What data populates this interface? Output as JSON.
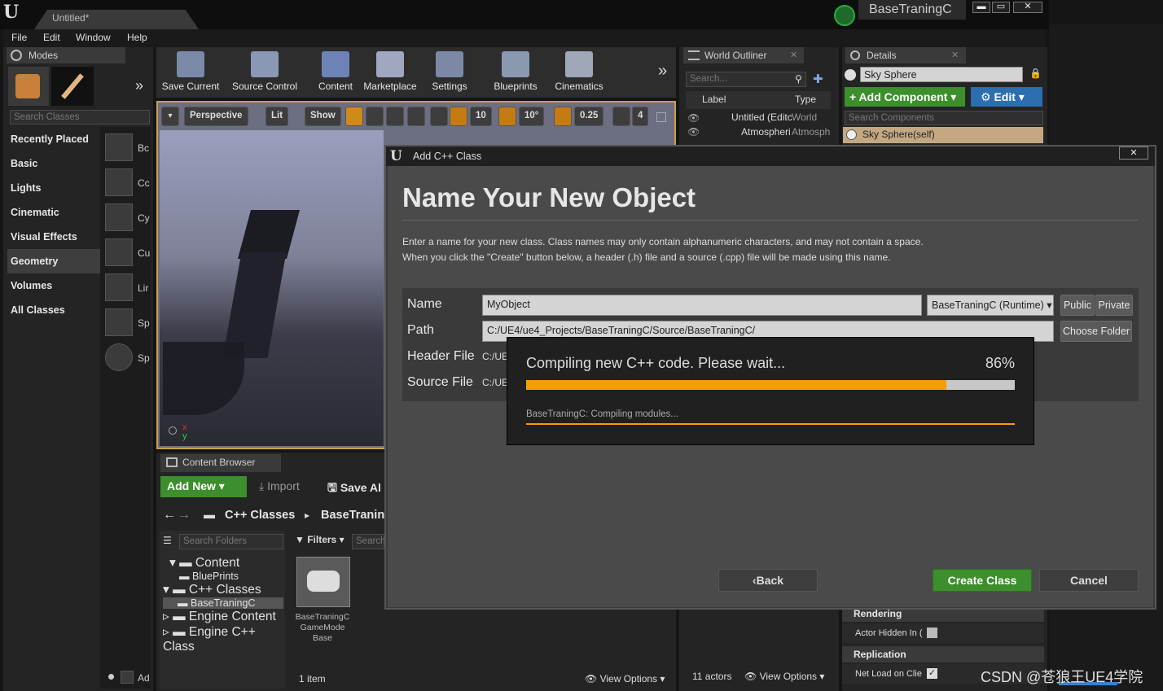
{
  "window": {
    "tab_title": "Untitled*",
    "project_name": "BaseTraningC",
    "min": "▬",
    "max": "▭",
    "close": "✕"
  },
  "menu": [
    "File",
    "Edit",
    "Window",
    "Help"
  ],
  "modes": {
    "tab": "Modes",
    "search_placeholder": "Search Classes",
    "categories": [
      "Recently Placed",
      "Basic",
      "Lights",
      "Cinematic",
      "Visual Effects",
      "Geometry",
      "Volumes",
      "All Classes"
    ],
    "selected_category": "Geometry",
    "items": [
      "Bc",
      "Cc",
      "Cy",
      "Cu",
      "Lir",
      "Sp",
      "Sp"
    ],
    "bottom_label": "Ad"
  },
  "toolbar": {
    "buttons": [
      "Save Current",
      "Source Control",
      "Content",
      "Marketplace",
      "Settings",
      "Blueprints",
      "Cinematics"
    ],
    "more": "»"
  },
  "viewport": {
    "perspective": "Perspective",
    "lit": "Lit",
    "show": "Show",
    "grid_snap": "10",
    "rot_snap": "10°",
    "scale_snap": "0.25",
    "cam_speed": "4",
    "axis_x": "x",
    "axis_y": "y"
  },
  "world_outliner": {
    "tab": "World Outliner",
    "search_placeholder": "Search...",
    "col_label": "Label",
    "col_type": "Type",
    "rows": [
      {
        "label": "Untitled (Editc",
        "type": "World"
      },
      {
        "label": "Atmospheri",
        "type": "Atmosph"
      }
    ],
    "actors": "11 actors",
    "view_options": "View Options"
  },
  "details": {
    "tab": "Details",
    "object_name": "Sky Sphere",
    "add_component": "+ Add Component",
    "edit": "Edit",
    "search_placeholder": "Search Components",
    "self_row": "Sky Sphere(self)",
    "section_rendering": "Rendering",
    "actor_hidden": "Actor Hidden In (",
    "section_replication": "Replication",
    "net_load": "Net Load on Clie"
  },
  "content_browser": {
    "tab": "Content Browser",
    "add_new": "Add New",
    "import": "Import",
    "save_all": "Save Al",
    "path": [
      "C++ Classes",
      "BaseTranin"
    ],
    "search_folders": "Search Folders",
    "filters": "Filters",
    "search_assets": "Search",
    "tree": [
      "Content",
      "BluePrints",
      "C++ Classes",
      "BaseTraningC",
      "Engine Content",
      "Engine C++ Class"
    ],
    "asset_name": [
      "BaseTraningC",
      "GameMode",
      "Base"
    ],
    "item_count": "1 item",
    "view_options": "View Options"
  },
  "dialog": {
    "title": "Add C++ Class",
    "heading": "Name Your New Object",
    "desc1": "Enter a name for your new class. Class names may only contain alphanumeric characters, and may not contain a space.",
    "desc2": "When you click the \"Create\" button below, a header (.h) file and a source (.cpp) file will be made using this name.",
    "name_label": "Name",
    "name_value": "MyObject",
    "module": "BaseTraningC (Runtime)",
    "public": "Public",
    "private": "Private",
    "path_label": "Path",
    "path_value": "C:/UE4/ue4_Projects/BaseTraningC/Source/BaseTraningC/",
    "choose_folder": "Choose Folder",
    "header_label": "Header File",
    "header_value": "C:/UE",
    "source_label": "Source File",
    "source_value": "C:/UE",
    "back": "Back",
    "create": "Create Class",
    "cancel": "Cancel"
  },
  "progress": {
    "message": "Compiling new C++ code.  Please wait...",
    "percent_label": "86%",
    "fraction": 0.86,
    "status": "BaseTraningC: Compiling modules..."
  },
  "watermark": "CSDN @苍狼王UE4学院",
  "colors": {
    "accent_orange": "#f0a000",
    "green": "#3c8f2c",
    "blue": "#2b6fb0"
  }
}
